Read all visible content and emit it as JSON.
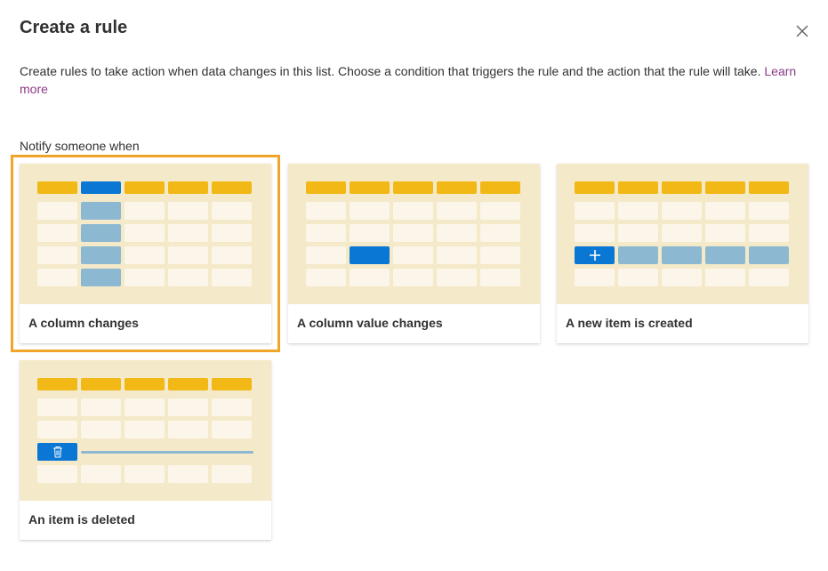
{
  "dialog": {
    "title": "Create a rule",
    "description": "Create rules to take action when data changes in this list. Choose a condition that triggers the rule and the action that the rule will take.",
    "learn_more": "Learn more",
    "section_label": "Notify someone when"
  },
  "cards": [
    {
      "label": "A column changes",
      "selected": true
    },
    {
      "label": "A column value changes",
      "selected": false
    },
    {
      "label": "A new item is created",
      "selected": false
    },
    {
      "label": "An item is deleted",
      "selected": false
    }
  ],
  "icons": {
    "close": "close-icon",
    "plus": "plus-icon",
    "trash": "trash-icon"
  },
  "colors": {
    "header_cell": "#f1b816",
    "cell": "#fcf6ea",
    "illustration_bg": "#f4e9c9",
    "highlight_blue": "#0a77d4",
    "muted_blue": "#8cb8d2",
    "selection_outline": "#f0a52a",
    "link": "#8a3b87"
  }
}
